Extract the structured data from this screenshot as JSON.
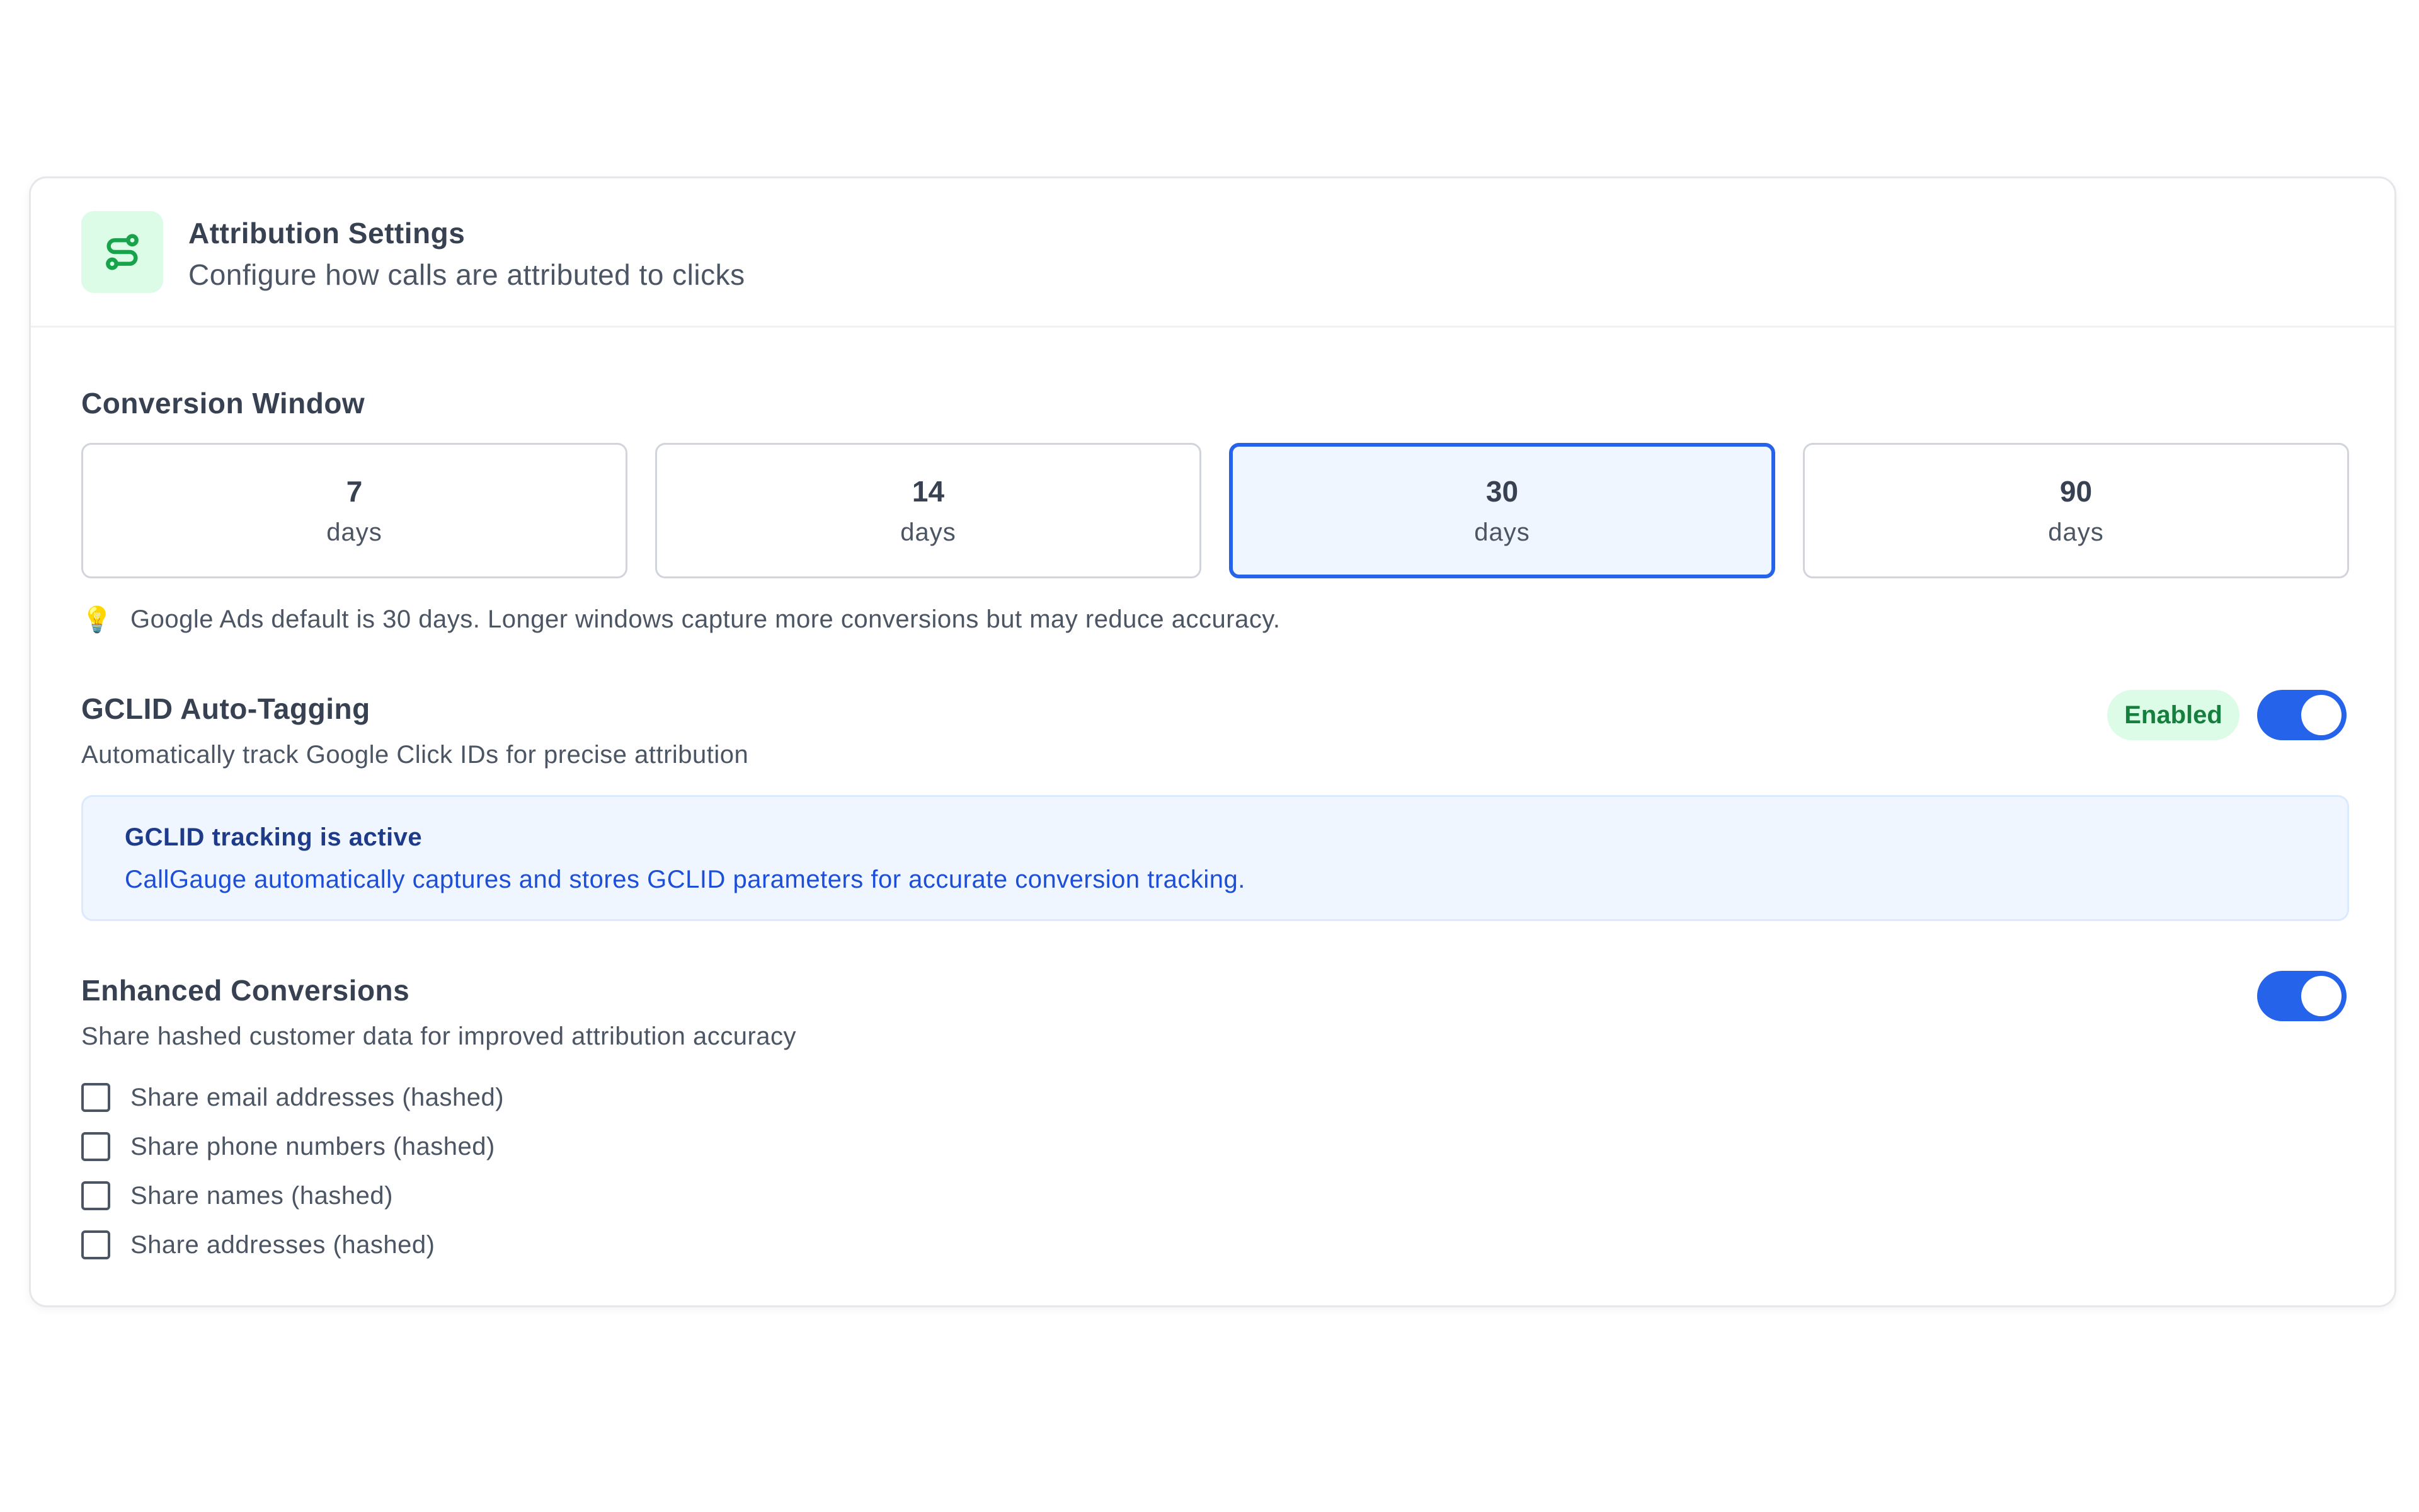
{
  "header": {
    "icon": "route-icon",
    "title": "Attribution Settings",
    "subtitle": "Configure how calls are attributed to clicks"
  },
  "conversion_window": {
    "label": "Conversion Window",
    "options": [
      {
        "value": "7",
        "unit": "days",
        "selected": false
      },
      {
        "value": "14",
        "unit": "days",
        "selected": false
      },
      {
        "value": "30",
        "unit": "days",
        "selected": true
      },
      {
        "value": "90",
        "unit": "days",
        "selected": false
      }
    ],
    "hint_icon": "lightbulb-icon",
    "hint": "Google Ads default is 30 days. Longer windows capture more conversions but may reduce accuracy."
  },
  "gclid": {
    "title": "GCLID Auto-Tagging",
    "description": "Automatically track Google Click IDs for precise attribution",
    "status_badge": "Enabled",
    "toggle_on": true,
    "info_title": "GCLID tracking is active",
    "info_text": "CallGauge automatically captures and stores GCLID parameters for accurate conversion tracking."
  },
  "enhanced_conversions": {
    "title": "Enhanced Conversions",
    "description": "Share hashed customer data for improved attribution accuracy",
    "toggle_on": true,
    "options": [
      {
        "label": "Share email addresses (hashed)",
        "checked": false
      },
      {
        "label": "Share phone numbers (hashed)",
        "checked": false
      },
      {
        "label": "Share names (hashed)",
        "checked": false
      },
      {
        "label": "Share addresses (hashed)",
        "checked": false
      }
    ]
  },
  "colors": {
    "accent": "#2563eb",
    "success": "#15803d",
    "success_bg": "#dcfce7",
    "info_bg": "#eff6ff"
  }
}
